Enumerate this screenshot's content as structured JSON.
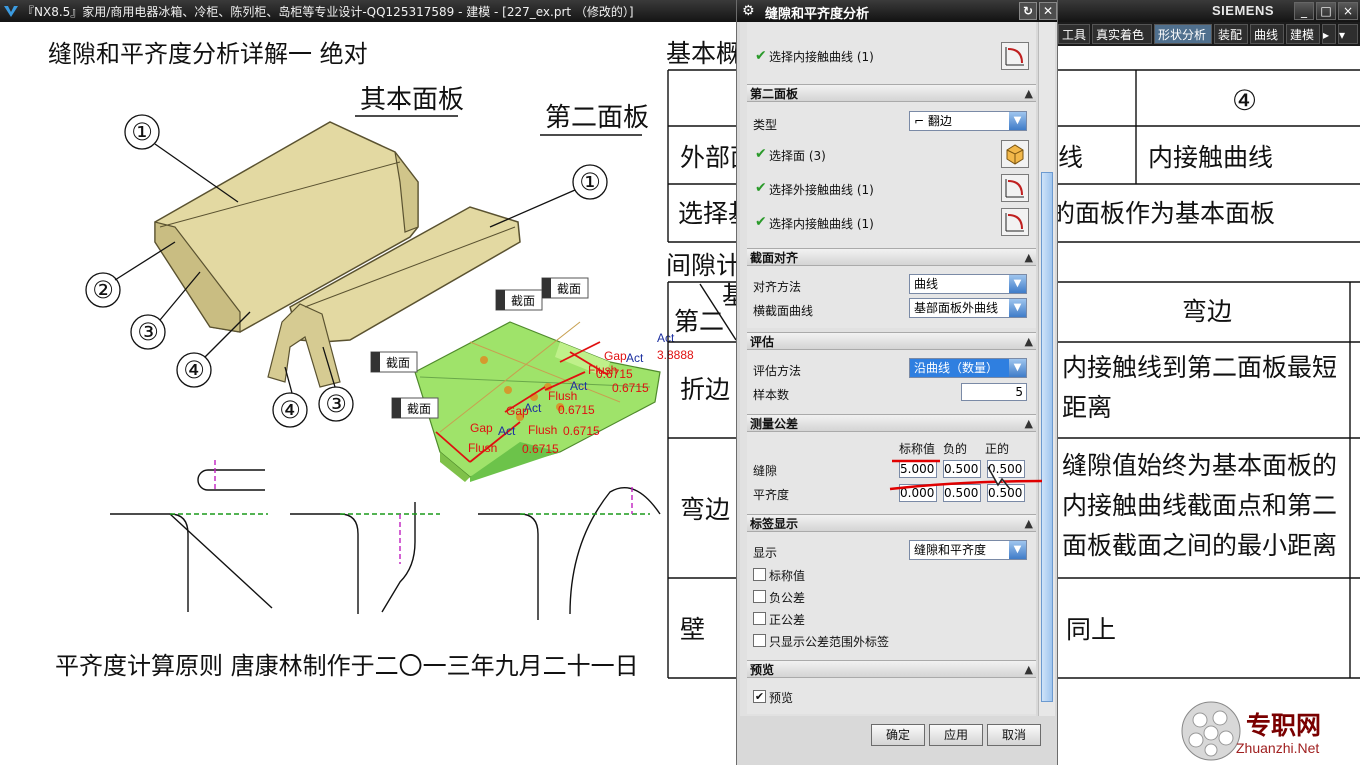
{
  "window": {
    "title": "『NX8.5』家用/商用电器冰箱、冷柜、陈列柜、岛柜等专业设计-QQ125317589 - 建模 - [227_ex.prt （修改的）]",
    "brand": "SIEMENS",
    "controls": [
      "_",
      "□",
      "×"
    ]
  },
  "ribbon": {
    "tabs": [
      "工具",
      "真实着色",
      "形状分析",
      "装配",
      "曲线",
      "建模"
    ],
    "active": "形状分析"
  },
  "drawing": {
    "heading": "缝隙和平齐度分析详解一  绝对",
    "base_panel_label": "其本面板",
    "second_panel_label": "第二面板",
    "callouts": [
      "①",
      "②",
      "③",
      "④"
    ],
    "section_tags": [
      "截面",
      "截面",
      "截面",
      "截面"
    ],
    "measure_labels": {
      "act": "Act",
      "gap": "Gap",
      "flush": "Flush",
      "value1": "3.8888",
      "value2": "0.6715"
    },
    "footer": "平齐度计算原则   唐康林制作于二〇一三年九月二十一日"
  },
  "table": {
    "title_left": "基本概",
    "subtitle_left": "间隙计",
    "header_circle": "④",
    "row_outer_left": "外部面",
    "row_outer_mid": "线",
    "row_outer_right": "内接触曲线",
    "row_select_left": "选择基",
    "row_select_right": "的面板作为基本面板",
    "sec_left": "第二",
    "sec_left_top": "基",
    "sec_right": "弯边",
    "fold_left": "折边",
    "fold_right": "内接触线到第二面板最短距离",
    "bend_left": "弯边",
    "bend_right": "缝隙值始终为基本面板的内接触曲线截面点和第二面板截面之间的最小距离",
    "wall_left": "壁",
    "wall_right": "同上"
  },
  "dialog": {
    "title": "缝隙和平齐度分析",
    "top_partial_row": "选择内接触曲线 (1)",
    "second_panel": {
      "header": "第二面板",
      "type_label": "类型",
      "type_value": "翻边",
      "rows": [
        "选择面 (3)",
        "选择外接触曲线 (1)",
        "选择内接触曲线 (1)"
      ]
    },
    "section_align": {
      "header": "截面对齐",
      "method_label": "对齐方法",
      "method_value": "曲线",
      "curve_label": "横截面曲线",
      "curve_value": "基部面板外曲线"
    },
    "evaluation": {
      "header": "评估",
      "method_label": "评估方法",
      "method_value": "沿曲线（数量）",
      "samples_label": "样本数",
      "samples_value": "5"
    },
    "tolerance": {
      "header": "测量公差",
      "col_nominal": "标称值",
      "col_neg": "负的",
      "col_pos": "正的",
      "gap_label": "缝隙",
      "flush_label": "平齐度",
      "gap_values": [
        "5.000",
        "0.500",
        "0.500"
      ],
      "flush_values": [
        "0.000",
        "0.500",
        "0.500"
      ]
    },
    "label_display": {
      "header": "标签显示",
      "show_label": "显示",
      "show_value": "缝隙和平齐度",
      "options": [
        "标称值",
        "负公差",
        "正公差",
        "只显示公差范围外标签"
      ]
    },
    "preview": {
      "header": "预览",
      "option": "预览",
      "checked": true
    },
    "buttons": {
      "ok": "确定",
      "apply": "应用",
      "cancel": "取消"
    }
  },
  "watermark": {
    "name": "专职网",
    "url": "Zhuanzhi.Net"
  },
  "colors": {
    "panel": "#e3d9a2",
    "panel_dark": "#b8ab6c",
    "second_panel": "#9fe36a",
    "measure_red": "#e01010",
    "accent_blue": "#2f7fe0"
  }
}
